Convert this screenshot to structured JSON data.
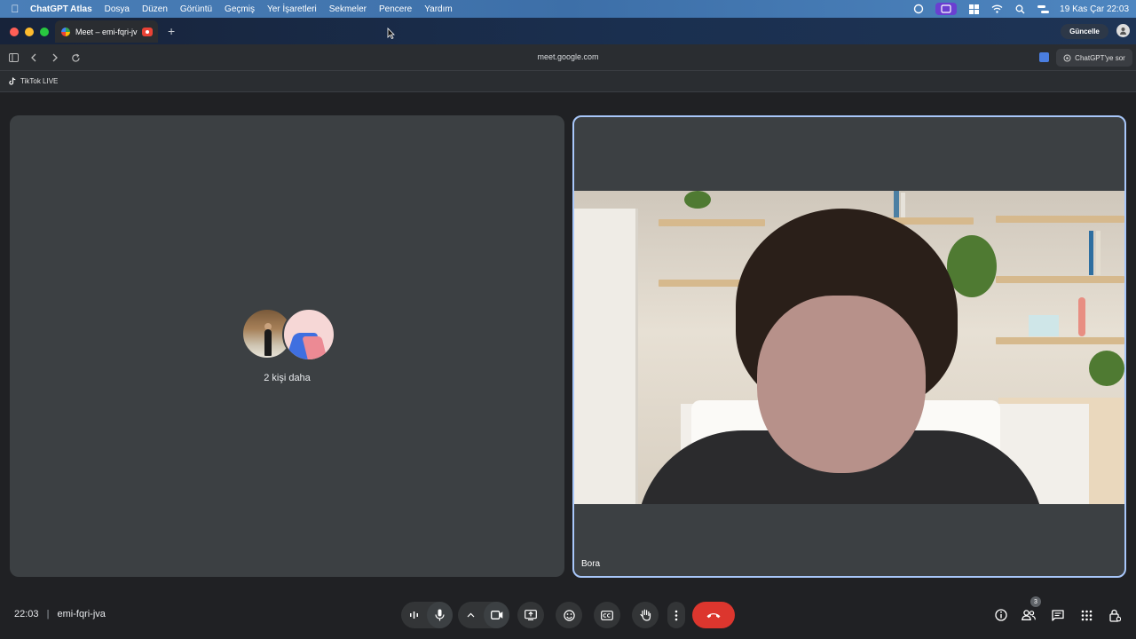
{
  "menubar": {
    "app": "ChatGPT Atlas",
    "items": [
      "Dosya",
      "Düzen",
      "Görüntü",
      "Geçmiş",
      "Yer İşaretleri",
      "Sekmeler",
      "Pencere",
      "Yardım"
    ],
    "clock": "19 Kas Çar  22:03"
  },
  "tabs": [
    {
      "label": "Meet – emi-fqri-jv",
      "active": true
    }
  ],
  "browser": {
    "update_label": "Güncelle",
    "url": "meet.google.com",
    "ask_label": "ChatGPT'ye sor"
  },
  "bookmarks": [
    {
      "label": "TikTok LIVE"
    }
  ],
  "meet": {
    "others_label": "2 kişi daha",
    "participant_name": "Bora",
    "time": "22:03",
    "separator": "|",
    "meeting_code": "emi-fqri-jva",
    "participants_count": "3"
  },
  "colors": {
    "hangup": "#dc362e",
    "active_border": "#a8c7fa",
    "tile_bg": "#3c4043",
    "control_bg": "#333537"
  },
  "icons": {
    "controls": [
      "audio-levels-icon",
      "microphone-icon",
      "chevron-up-icon",
      "camera-icon",
      "present-screen-icon",
      "emoji-icon",
      "captions-icon",
      "raise-hand-icon",
      "more-options-icon",
      "hang-up-icon"
    ],
    "right": [
      "info-icon",
      "people-icon",
      "chat-icon",
      "activities-icon",
      "host-controls-icon"
    ]
  }
}
